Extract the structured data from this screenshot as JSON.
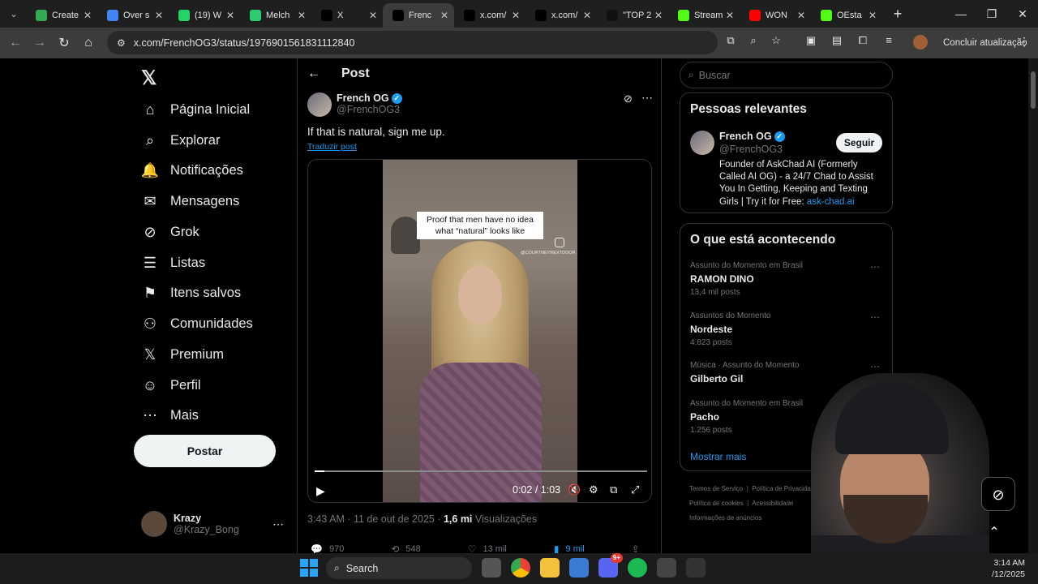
{
  "browser": {
    "tabs": [
      {
        "title": "Create",
        "icon": "doc-icon",
        "color": "#34a853"
      },
      {
        "title": "Over s",
        "icon": "google-icon",
        "color": "#4285f4"
      },
      {
        "title": "(19) W",
        "icon": "whatsapp-icon",
        "color": "#25d366"
      },
      {
        "title": "Melch",
        "icon": "bookmark-app-icon",
        "color": "#2ecc71"
      },
      {
        "title": "X",
        "icon": "x-icon",
        "color": "#000000"
      },
      {
        "title": "Frenc",
        "icon": "x-icon",
        "color": "#000000",
        "active": true
      },
      {
        "title": "x.com/",
        "icon": "x-icon",
        "color": "#000000"
      },
      {
        "title": "x.com/",
        "icon": "x-icon",
        "color": "#000000"
      },
      {
        "title": "\"TOP 2",
        "icon": "b-icon",
        "color": "#111111"
      },
      {
        "title": "Stream",
        "icon": "kick-icon",
        "color": "#53fc18"
      },
      {
        "title": "WON",
        "icon": "youtube-icon",
        "color": "#ff0000"
      },
      {
        "title": "OEsta",
        "icon": "kick-icon",
        "color": "#53fc18"
      }
    ],
    "url": "x.com/FrenchOG3/status/1976901561831112840",
    "update_label": "Concluir atualização"
  },
  "nav": {
    "items": [
      {
        "label": "Página Inicial",
        "icon": "home-icon",
        "glyph": "⌂"
      },
      {
        "label": "Explorar",
        "icon": "search-icon",
        "glyph": "⌕"
      },
      {
        "label": "Notificações",
        "icon": "bell-icon",
        "glyph": "🔔"
      },
      {
        "label": "Mensagens",
        "icon": "mail-icon",
        "glyph": "✉"
      },
      {
        "label": "Grok",
        "icon": "grok-icon",
        "glyph": "⊘"
      },
      {
        "label": "Listas",
        "icon": "list-icon",
        "glyph": "☰"
      },
      {
        "label": "Itens salvos",
        "icon": "bookmark-icon",
        "glyph": "⚑"
      },
      {
        "label": "Comunidades",
        "icon": "communities-icon",
        "glyph": "⚇"
      },
      {
        "label": "Premium",
        "icon": "x-icon",
        "glyph": "𝕏"
      },
      {
        "label": "Perfil",
        "icon": "profile-icon",
        "glyph": "☺"
      },
      {
        "label": "Mais",
        "icon": "more-circle-icon",
        "glyph": "⋯"
      }
    ],
    "post_button": "Postar",
    "user": {
      "name": "Krazy",
      "handle": "@Krazy_Bong"
    }
  },
  "post": {
    "header": "Post",
    "author_name": "French OG",
    "author_handle": "@FrenchOG3",
    "text": "If that is natural, sign me up.",
    "translate_label": "Traduzir post",
    "video": {
      "caption": "Proof that men have no idea what “natural” looks like",
      "watermark": "@COURTNEYNEXTDOOR",
      "current_time": "0:02",
      "duration": "1:03",
      "progress_fraction": 0.03
    },
    "time": "3:43 AM",
    "date": "11 de out de 2025",
    "views_count": "1,6 mi",
    "views_label": "Visualizações",
    "stats": {
      "replies": "970",
      "reposts": "548",
      "likes": "13 mil",
      "bookmarks": "9 mil"
    }
  },
  "right": {
    "search_placeholder": "Buscar",
    "relevant_title": "Pessoas relevantes",
    "relevant": {
      "name": "French OG",
      "handle": "@FrenchOG3",
      "follow_label": "Seguir",
      "bio": "Founder of AskChad AI (Formerly Called AI OG) - a 24/7 Chad to Assist You In Getting, Keeping and Texting Girls | Try it for Free:",
      "bio_link": "ask-chad.ai"
    },
    "trends_title": "O que está acontecendo",
    "trends": [
      {
        "context": "Assunto do Momento em Brasil",
        "name": "RAMON DINO",
        "count": "13,4 mil posts"
      },
      {
        "context": "Assuntos do Momento",
        "name": "Nordeste",
        "count": "4.823 posts"
      },
      {
        "context": "Música · Assunto do Momento",
        "name": "Gilberto Gil",
        "count": ""
      },
      {
        "context": "Assunto do Momento em Brasil",
        "name": "Pacho",
        "count": "1.256 posts"
      }
    ],
    "show_more": "Mostrar mais",
    "footer": [
      "Termos de Serviço",
      "Política de Privacidade",
      "Política de cookies",
      "Acessibilidade",
      "Informações de anúncios"
    ]
  },
  "taskbar": {
    "search_label": "Search",
    "time": "3:14 AM",
    "date": "/12/2025",
    "discord_badge": "9+"
  }
}
